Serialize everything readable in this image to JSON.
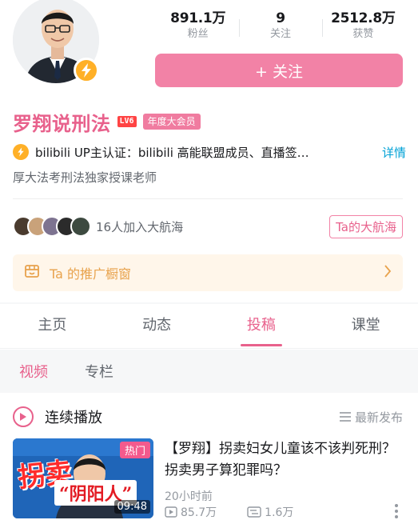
{
  "profile": {
    "username": "罗翔说刑法",
    "level": "LV6",
    "vip_badge": "年度大会员",
    "cert_text": "bilibili  UP主认证：bilibili  高能联盟成员、直播签…",
    "cert_more": "详情",
    "bio": "厚大法考刑法独家授课老师"
  },
  "stats": [
    {
      "value": "891.1万",
      "label": "粉丝"
    },
    {
      "value": "9",
      "label": "关注"
    },
    {
      "value": "2512.8万",
      "label": "获赞"
    }
  ],
  "follow_button": "+ 关注",
  "guard": {
    "text": "16人加入大航海",
    "button": "Ta的大航海"
  },
  "shop": {
    "label": "Ta 的推广橱窗"
  },
  "tabs": [
    {
      "label": "主页",
      "active": false
    },
    {
      "label": "动态",
      "active": false
    },
    {
      "label": "投稿",
      "active": true
    },
    {
      "label": "课堂",
      "active": false
    }
  ],
  "subtabs": [
    {
      "label": "视频",
      "active": true
    },
    {
      "label": "专栏",
      "active": false
    }
  ],
  "list": {
    "title": "连续播放",
    "sort": "最新发布"
  },
  "video": {
    "hot": "热门",
    "duration": "09:48",
    "thumb_text_1": "拐卖",
    "thumb_text_2": "“阴阳人”",
    "title": "【罗翔】拐卖妇女儿童该不该判死刑？拐卖男子算犯罪吗？",
    "time": "20小时前",
    "views": "85.7万",
    "danmaku": "1.6万"
  },
  "colors": {
    "brand_pink": "#e8618c",
    "follow_button": "#f282a6",
    "verify_gold": "#ffb027",
    "link_blue": "#00a1d6"
  }
}
